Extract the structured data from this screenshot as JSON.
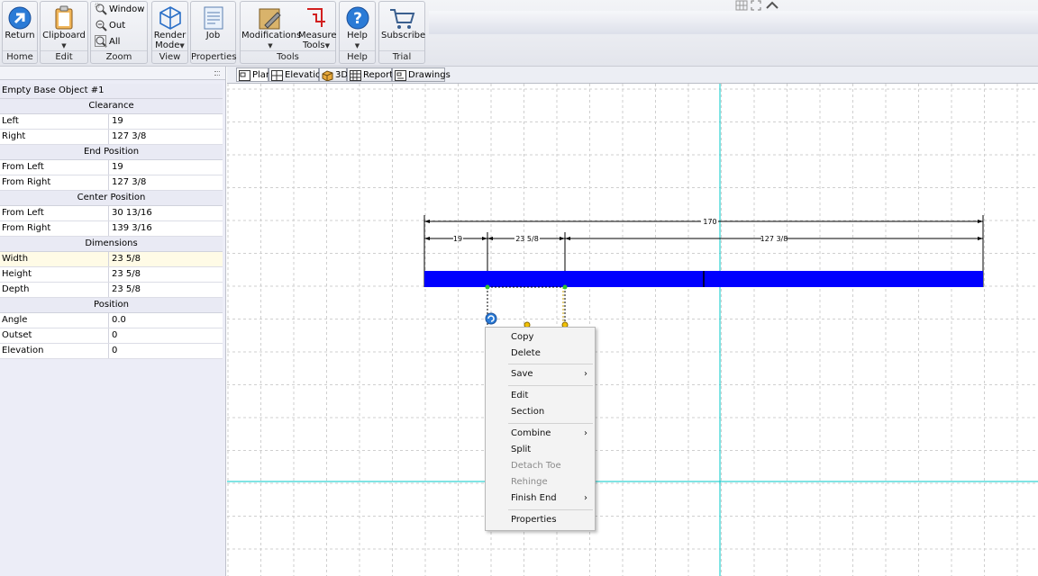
{
  "ribbon": {
    "groups": [
      {
        "label": "Home",
        "buttons": [
          {
            "label": "Return",
            "icon": "return-arrow-icon"
          }
        ]
      },
      {
        "label": "Edit",
        "buttons": [
          {
            "label": "Clipboard",
            "icon": "clipboard-icon"
          }
        ]
      },
      {
        "label": "Zoom",
        "items": [
          {
            "label": "Window",
            "icon": "zoom-window-icon"
          },
          {
            "label": "Out",
            "icon": "zoom-out-icon"
          },
          {
            "label": "All",
            "icon": "zoom-all-icon"
          }
        ]
      },
      {
        "label": "View",
        "buttons": [
          {
            "label": "Render",
            "label2": "Mode",
            "icon": "cube-icon"
          }
        ]
      },
      {
        "label": "Properties",
        "buttons": [
          {
            "label": "Job",
            "icon": "job-sheet-icon"
          }
        ]
      },
      {
        "label": "Tools",
        "buttons": [
          {
            "label": "Modifications",
            "icon": "modifications-icon"
          },
          {
            "label": "Measure",
            "label2": "Tools",
            "icon": "measure-icon"
          }
        ]
      },
      {
        "label": "Help",
        "buttons": [
          {
            "label": "Help",
            "icon": "help-icon"
          }
        ]
      },
      {
        "label": "Trial",
        "buttons": [
          {
            "label": "Subscribe",
            "icon": "cart-icon"
          }
        ]
      }
    ]
  },
  "properties": {
    "title": "Empty Base Object #1",
    "sections": [
      {
        "name": "Clearance",
        "rows": [
          [
            "Left",
            "19"
          ],
          [
            "Right",
            "127 3/8"
          ]
        ]
      },
      {
        "name": "End Position",
        "rows": [
          [
            "From Left",
            "19"
          ],
          [
            "From Right",
            "127 3/8"
          ]
        ]
      },
      {
        "name": "Center Position",
        "rows": [
          [
            "From Left",
            "30 13/16"
          ],
          [
            "From Right",
            "139 3/16"
          ]
        ]
      },
      {
        "name": "Dimensions",
        "rows": [
          [
            "Width",
            "23 5/8"
          ],
          [
            "Height",
            "23 5/8"
          ],
          [
            "Depth",
            "23 5/8"
          ]
        ]
      },
      {
        "name": "Position",
        "rows": [
          [
            "Angle",
            "0.0"
          ],
          [
            "Outset",
            "0"
          ],
          [
            "Elevation",
            "0"
          ]
        ]
      }
    ]
  },
  "tabs": [
    "Plan",
    "Elevation",
    "3D",
    "Reports",
    "Drawings"
  ],
  "drawing": {
    "dims": {
      "overall": "170",
      "left": "19",
      "mid": "23 5/8",
      "right": "127 3/8"
    },
    "bar_color": "#0000ff",
    "guide_color": "#00c8c8"
  },
  "context_menu": {
    "items": [
      {
        "label": "Copy"
      },
      {
        "label": "Delete"
      },
      {
        "label": "Save",
        "submenu": true
      },
      {
        "label": "Edit"
      },
      {
        "label": "Section"
      },
      {
        "label": "Combine",
        "submenu": true
      },
      {
        "label": "Split"
      },
      {
        "label": "Detach Toe",
        "disabled": true
      },
      {
        "label": "Rehinge",
        "disabled": true
      },
      {
        "label": "Finish End",
        "submenu": true
      },
      {
        "label": "Properties"
      }
    ]
  }
}
